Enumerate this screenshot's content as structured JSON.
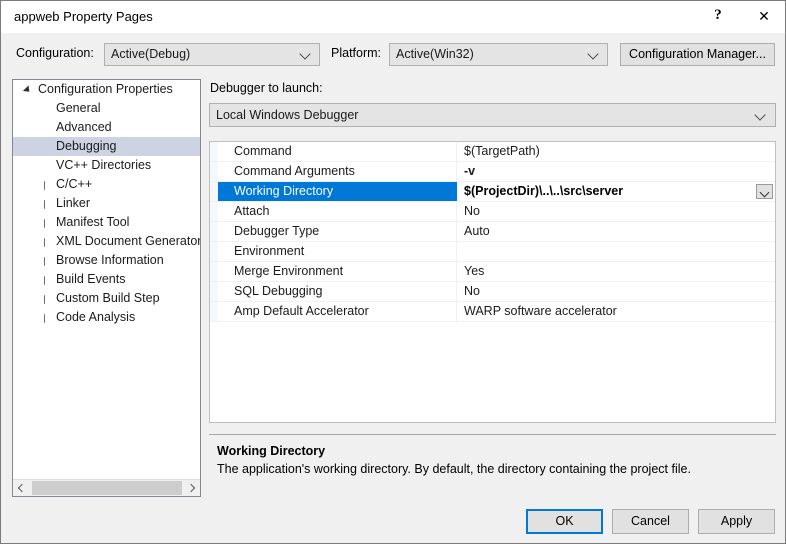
{
  "window": {
    "title": "appweb Property Pages",
    "help_icon": "question-mark-icon",
    "close_icon": "close-icon"
  },
  "config_bar": {
    "configuration_label": "Configuration:",
    "configuration_value": "Active(Debug)",
    "platform_label": "Platform:",
    "platform_value": "Active(Win32)",
    "config_manager_label": "Configuration Manager..."
  },
  "tree": {
    "items": [
      {
        "label": "Configuration Properties",
        "indent": 0,
        "twisty": "expanded",
        "selected": false
      },
      {
        "label": "General",
        "indent": 1,
        "twisty": "none",
        "selected": false
      },
      {
        "label": "Advanced",
        "indent": 1,
        "twisty": "none",
        "selected": false
      },
      {
        "label": "Debugging",
        "indent": 1,
        "twisty": "none",
        "selected": true
      },
      {
        "label": "VC++ Directories",
        "indent": 1,
        "twisty": "none",
        "selected": false
      },
      {
        "label": "C/C++",
        "indent": 1,
        "twisty": "collapsed",
        "selected": false
      },
      {
        "label": "Linker",
        "indent": 1,
        "twisty": "collapsed",
        "selected": false
      },
      {
        "label": "Manifest Tool",
        "indent": 1,
        "twisty": "collapsed",
        "selected": false
      },
      {
        "label": "XML Document Generator",
        "indent": 1,
        "twisty": "collapsed",
        "selected": false
      },
      {
        "label": "Browse Information",
        "indent": 1,
        "twisty": "collapsed",
        "selected": false
      },
      {
        "label": "Build Events",
        "indent": 1,
        "twisty": "collapsed",
        "selected": false
      },
      {
        "label": "Custom Build Step",
        "indent": 1,
        "twisty": "collapsed",
        "selected": false
      },
      {
        "label": "Code Analysis",
        "indent": 1,
        "twisty": "collapsed",
        "selected": false
      }
    ]
  },
  "right_panel": {
    "debugger_label": "Debugger to launch:",
    "debugger_value": "Local Windows Debugger"
  },
  "property_grid": {
    "rows": [
      {
        "name": "Command",
        "value": "$(TargetPath)",
        "bold": false,
        "selected": false
      },
      {
        "name": "Command Arguments",
        "value": "-v",
        "bold": true,
        "selected": false
      },
      {
        "name": "Working Directory",
        "value": "$(ProjectDir)\\..\\..\\src\\server",
        "bold": true,
        "selected": true
      },
      {
        "name": "Attach",
        "value": "No",
        "bold": false,
        "selected": false
      },
      {
        "name": "Debugger Type",
        "value": "Auto",
        "bold": false,
        "selected": false
      },
      {
        "name": "Environment",
        "value": "",
        "bold": false,
        "selected": false
      },
      {
        "name": "Merge Environment",
        "value": "Yes",
        "bold": false,
        "selected": false
      },
      {
        "name": "SQL Debugging",
        "value": "No",
        "bold": false,
        "selected": false
      },
      {
        "name": "Amp Default Accelerator",
        "value": "WARP software accelerator",
        "bold": false,
        "selected": false
      }
    ]
  },
  "description": {
    "title": "Working Directory",
    "text": "The application's working directory. By default, the directory containing the project file."
  },
  "footer": {
    "ok_label": "OK",
    "cancel_label": "Cancel",
    "apply_label": "Apply"
  },
  "colors": {
    "selection_blue": "#0078d7",
    "tree_selection": "#cdd3e3",
    "dialog_background": "#f0f0f0",
    "grid_background": "#ffffff"
  }
}
